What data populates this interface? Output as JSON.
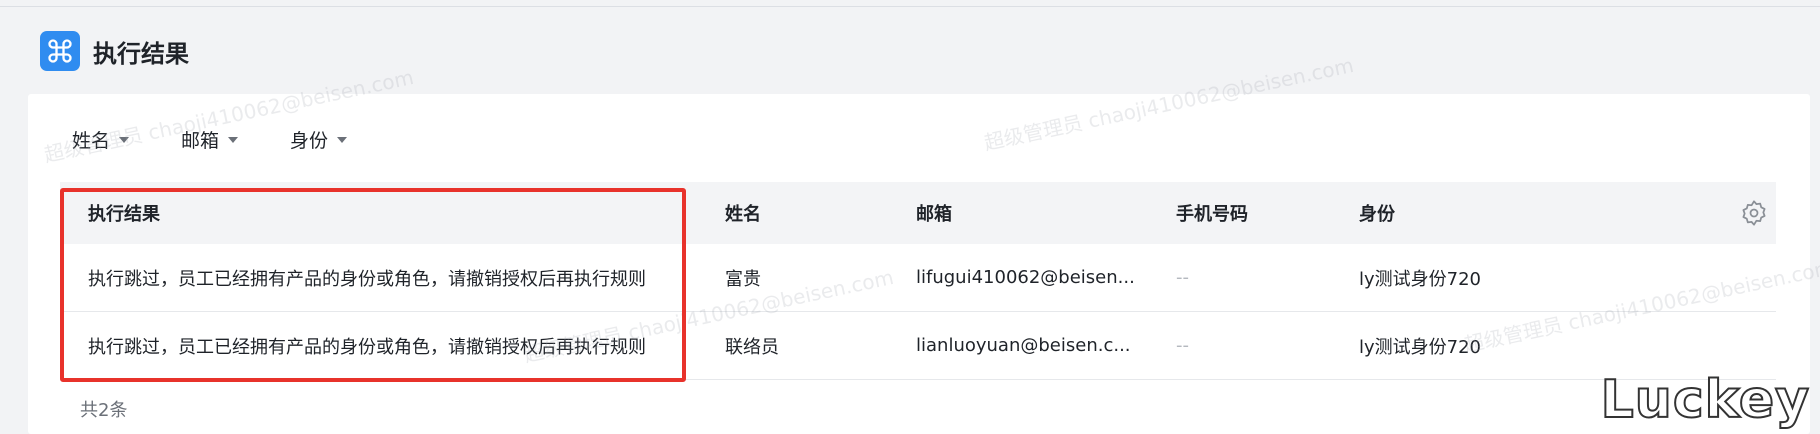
{
  "page": {
    "title": "执行结果",
    "logo_icon": "command-icon",
    "accent_color": "#2f8cf0",
    "highlight_color": "#e8322b"
  },
  "filters": [
    {
      "label": "姓名"
    },
    {
      "label": "邮箱"
    },
    {
      "label": "身份"
    }
  ],
  "table": {
    "columns": [
      "执行结果",
      "姓名",
      "邮箱",
      "手机号码",
      "身份"
    ],
    "settings_icon": "gear-icon",
    "rows": [
      {
        "result": "执行跳过，员工已经拥有产品的身份或角色，请撤销授权后再执行规则",
        "name": "富贵",
        "email": "lifugui410062@beisen...",
        "phone": "--",
        "identity": "ly测试身份720"
      },
      {
        "result": "执行跳过，员工已经拥有产品的身份或角色，请撤销授权后再执行规则",
        "name": "联络员",
        "email": "lianluoyuan@beisen.c...",
        "phone": "--",
        "identity": "ly测试身份720"
      }
    ]
  },
  "footer": {
    "total": "共2条"
  },
  "watermark": {
    "text": "超级管理员 chaoji410062@beisen.com"
  },
  "corner_brand": "Luckey"
}
